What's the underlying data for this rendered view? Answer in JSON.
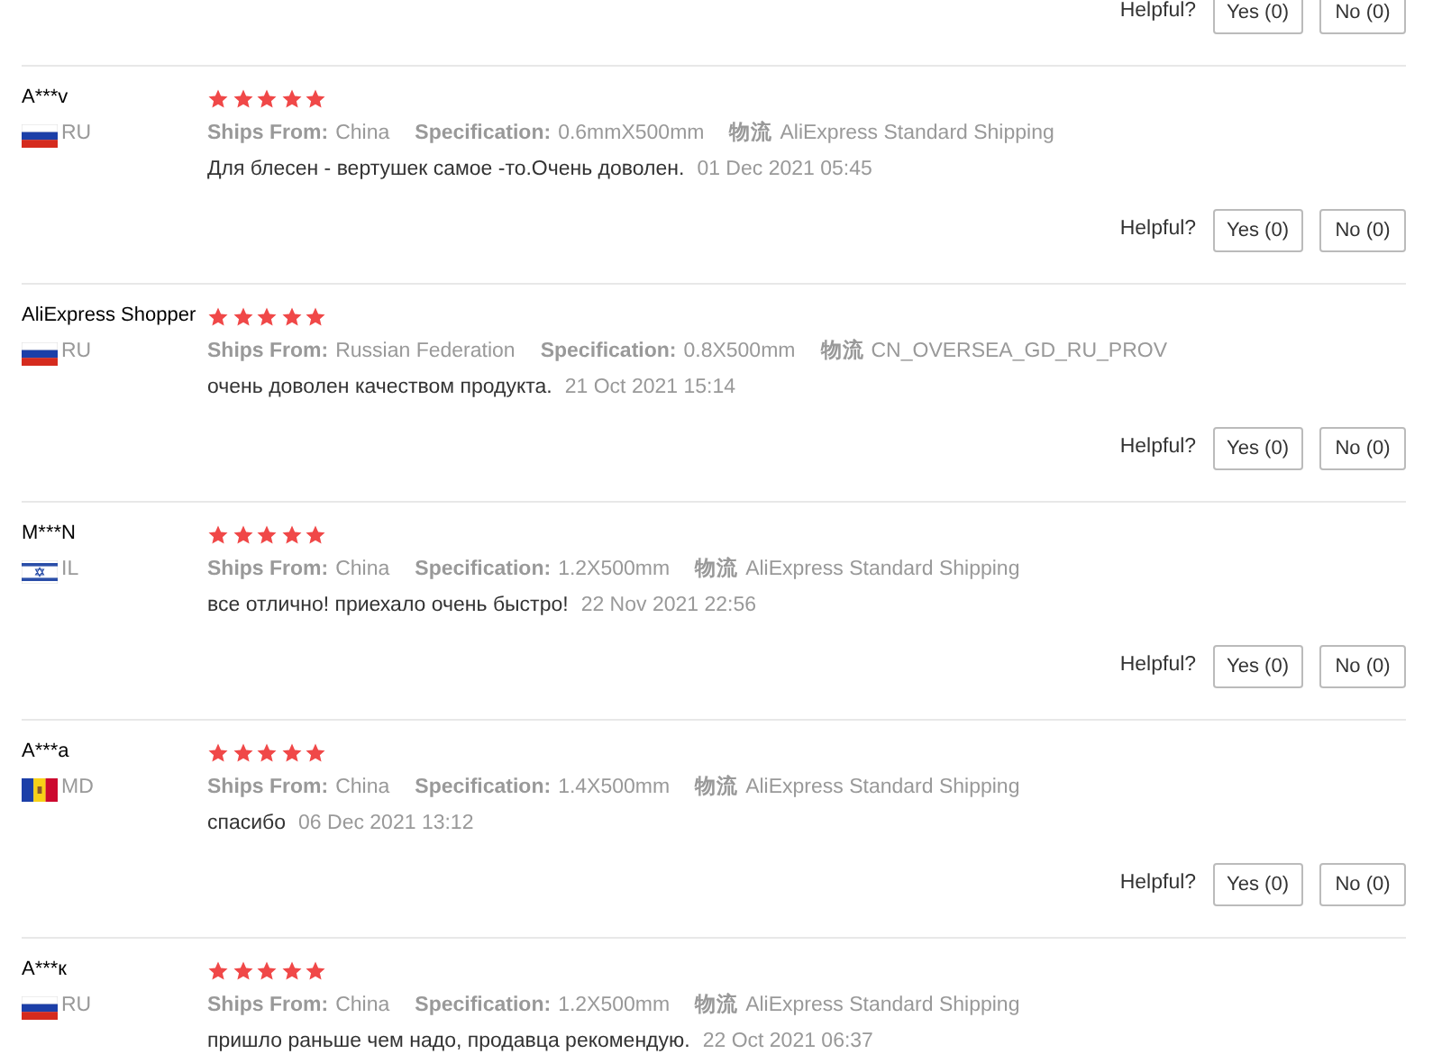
{
  "top_helpful": {
    "label": "Helpful?",
    "yes": "Yes (0)",
    "no": "No (0)"
  },
  "reviews": [
    {
      "name": "A***v",
      "flag": {
        "kind": "ru"
      },
      "country": "RU",
      "stars": 5,
      "meta": [
        {
          "label": "Ships From:",
          "value": "China"
        },
        {
          "label": "Specification:",
          "value": "0.6mmX500mm"
        },
        {
          "label": "物流",
          "value": "AliExpress Standard Shipping"
        }
      ],
      "comment": "Для блесен - вертушек самое -то.Очень доволен.",
      "date": "01 Dec 2021 05:45",
      "helpful": {
        "label": "Helpful?",
        "yes": "Yes (0)",
        "no": "No (0)"
      }
    },
    {
      "name": "AliExpress Shopper",
      "flag": {
        "kind": "ru"
      },
      "country": "RU",
      "stars": 5,
      "meta": [
        {
          "label": "Ships From:",
          "value": "Russian Federation"
        },
        {
          "label": "Specification:",
          "value": "0.8X500mm"
        },
        {
          "label": "物流",
          "value": "CN_OVERSEA_GD_RU_PROV"
        }
      ],
      "comment": "очень доволен качеством продукта.",
      "date": "21 Oct 2021 15:14",
      "helpful": {
        "label": "Helpful?",
        "yes": "Yes (0)",
        "no": "No (0)"
      }
    },
    {
      "name": "M***N",
      "flag": {
        "kind": "il"
      },
      "country": "IL",
      "stars": 5,
      "meta": [
        {
          "label": "Ships From:",
          "value": "China"
        },
        {
          "label": "Specification:",
          "value": "1.2X500mm"
        },
        {
          "label": "物流",
          "value": "AliExpress Standard Shipping"
        }
      ],
      "comment": "все отлично! приехало очень быстро!",
      "date": "22 Nov 2021 22:56",
      "helpful": {
        "label": "Helpful?",
        "yes": "Yes (0)",
        "no": "No (0)"
      }
    },
    {
      "name": "A***a",
      "flag": {
        "kind": "md"
      },
      "country": "MD",
      "stars": 5,
      "meta": [
        {
          "label": "Ships From:",
          "value": "China"
        },
        {
          "label": "Specification:",
          "value": "1.4X500mm"
        },
        {
          "label": "物流",
          "value": "AliExpress Standard Shipping"
        }
      ],
      "comment": "спасибо",
      "date": "06 Dec 2021 13:12",
      "helpful": {
        "label": "Helpful?",
        "yes": "Yes (0)",
        "no": "No (0)"
      }
    },
    {
      "name": "A***к",
      "flag": {
        "kind": "ru"
      },
      "country": "RU",
      "stars": 5,
      "meta": [
        {
          "label": "Ships From:",
          "value": "China"
        },
        {
          "label": "Specification:",
          "value": "1.2X500mm"
        },
        {
          "label": "物流",
          "value": "AliExpress Standard Shipping"
        }
      ],
      "comment": "пришло раньше чем надо, продавца рекомендую.",
      "date": "22 Oct 2021 06:37"
    }
  ]
}
